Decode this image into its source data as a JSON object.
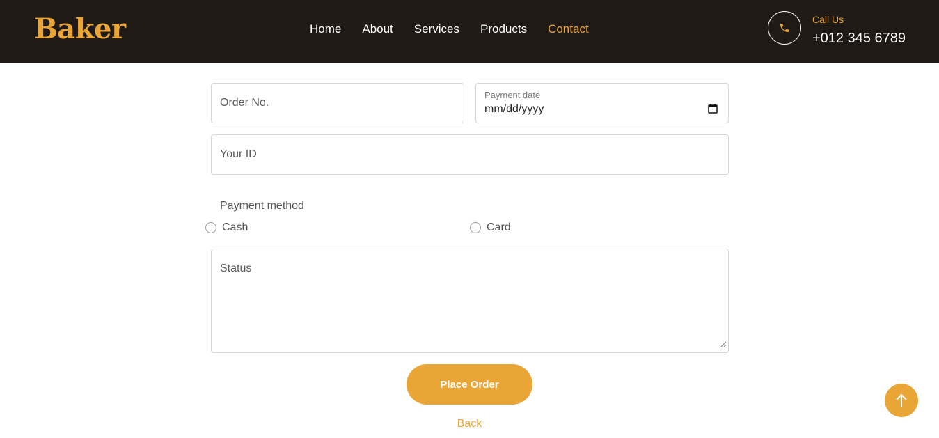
{
  "brand": {
    "name": "Baker"
  },
  "nav": {
    "items": [
      {
        "label": "Home",
        "active": false
      },
      {
        "label": "About",
        "active": false
      },
      {
        "label": "Services",
        "active": false
      },
      {
        "label": "Products",
        "active": false
      },
      {
        "label": "Contact",
        "active": true
      }
    ]
  },
  "contact": {
    "icon": "phone-icon",
    "label": "Call Us",
    "number": "+012 345 6789"
  },
  "form": {
    "order_no": {
      "placeholder": "Order No.",
      "value": ""
    },
    "payment_date": {
      "label": "Payment date",
      "value": "mm/dd/yyyy",
      "icon": "calendar-icon"
    },
    "your_id": {
      "placeholder": "Your ID",
      "value": ""
    },
    "payment_method": {
      "label": "Payment method",
      "options": [
        "Cash",
        "Card"
      ],
      "selected": null
    },
    "status": {
      "placeholder": "Status",
      "value": ""
    },
    "submit_label": "Place Order",
    "back_label": "Back"
  },
  "back_to_top": {
    "icon": "arrow-up-icon"
  },
  "colors": {
    "accent": "#e9a637",
    "navbar_bg": "#201a17",
    "text": "#555555",
    "border": "#d6d6d6"
  }
}
